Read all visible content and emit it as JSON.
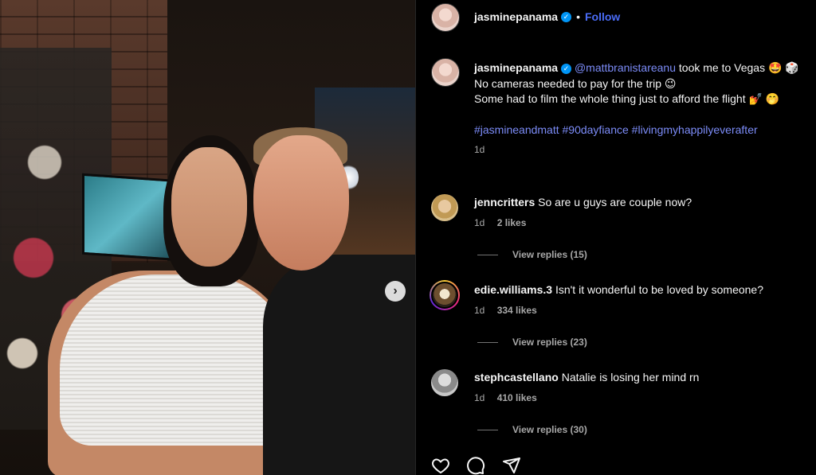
{
  "post": {
    "author": "jasminepanama",
    "follow_label": "Follow",
    "dot": "•",
    "verified_glyph": "✓",
    "caption": {
      "mention": "@mattbranistareanu",
      "line1_rest": " took me to Vegas 🤩 🎲",
      "line2": "No cameras needed to pay for the trip 😉",
      "line3": "Some had to film the whole thing just to afford the flight 💅 🤭",
      "hashtags": "#jasmineandmatt #90dayfiance #livingmyhappilyeverafter",
      "time": "1d"
    }
  },
  "comments": [
    {
      "user": "jenncritters",
      "text": "So are u guys are couple now?",
      "time": "1d",
      "likes": "2 likes",
      "replies": "View replies (15)"
    },
    {
      "user": "edie.williams.3",
      "text": "Isn't it wonderful to be loved by someone?",
      "time": "1d",
      "likes": "334 likes",
      "replies": "View replies (23)"
    },
    {
      "user": "stephcastellano",
      "text": "Natalie is losing her mind rn",
      "time": "1d",
      "likes": "410 likes",
      "replies": "View replies (30)"
    }
  ],
  "carousel": {
    "next_glyph": "›"
  },
  "icons": [
    "heart-icon",
    "comment-icon",
    "share-icon"
  ],
  "colors": {
    "accent": "#0095f6",
    "link": "#7c8cf8",
    "muted": "#a8a8a8"
  }
}
